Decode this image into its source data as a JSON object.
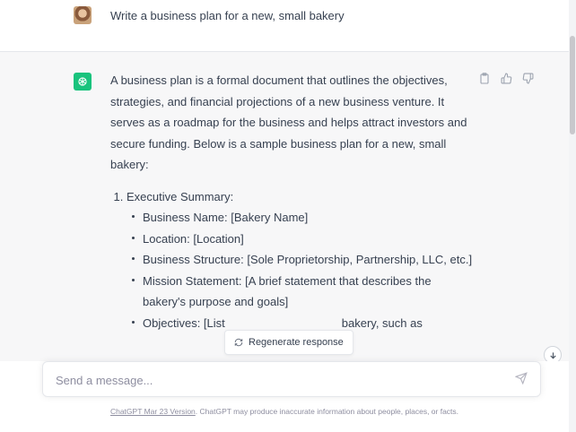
{
  "user_message": {
    "text": "Write a business plan for a new, small bakery"
  },
  "assistant_message": {
    "intro": "A business plan is a formal document that outlines the objectives, strategies, and financial projections of a new business venture. It serves as a roadmap for the business and helps attract investors and secure funding. Below is a sample business plan for a new, small bakery:",
    "sections": [
      {
        "title": "Executive Summary:",
        "items": [
          "Business Name: [Bakery Name]",
          "Location: [Location]",
          "Business Structure: [Sole Proprietorship, Partnership, LLC, etc.]",
          "Mission Statement: [A brief statement that describes the bakery's purpose and goals]",
          "Objectives: [List                                    bakery, such as"
        ]
      }
    ],
    "action_icons": [
      "clipboard-icon",
      "thumbs-up-icon",
      "thumbs-down-icon"
    ]
  },
  "regenerate": {
    "label": "Regenerate response"
  },
  "composer": {
    "placeholder": "Send a message..."
  },
  "footer": {
    "link_text": "ChatGPT Mar 23 Version",
    "text": ". ChatGPT may produce inaccurate information about people, places, or facts."
  },
  "colors": {
    "brand_green": "#19c37d",
    "assistant_bg": "#f7f7f8",
    "text": "#374151",
    "muted": "#8e8ea0"
  }
}
